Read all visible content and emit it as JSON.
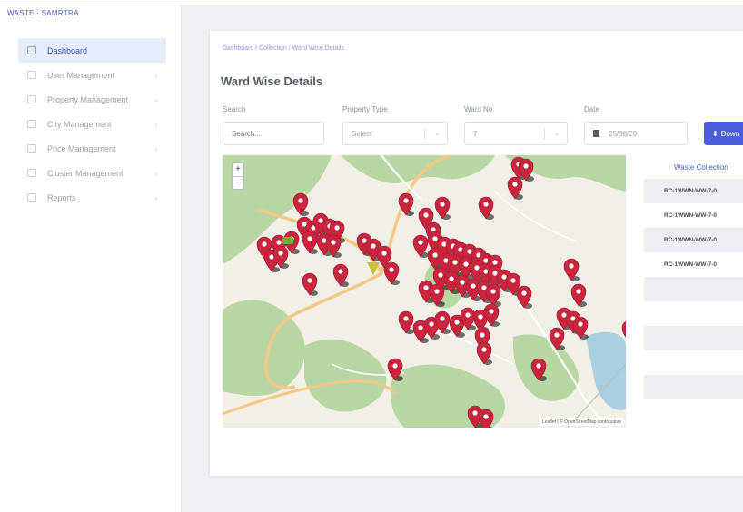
{
  "brand": {
    "text": "WASTE · SAMRTRA"
  },
  "sidebar": {
    "items": [
      {
        "label": "Dashboard",
        "active": true
      },
      {
        "label": "User Management",
        "active": false
      },
      {
        "label": "Property Management",
        "active": false
      },
      {
        "label": "City Management",
        "active": false
      },
      {
        "label": "Price Management",
        "active": false
      },
      {
        "label": "Cluster Management",
        "active": false
      },
      {
        "label": "Reports",
        "active": false
      }
    ]
  },
  "breadcrumb": {
    "text": "Dashboard / Collection / Ward Wise Details"
  },
  "page": {
    "title": "Ward Wise Details"
  },
  "filters": {
    "search": {
      "label": "Search",
      "placeholder": "Search..."
    },
    "property_type": {
      "label": "Property Type",
      "value": "Select"
    },
    "ward": {
      "label": "Ward No",
      "value": "7"
    },
    "date": {
      "label": "Date",
      "value": "25/08/20"
    },
    "download_label": "Down"
  },
  "map": {
    "zoom_in": "+",
    "zoom_out": "−",
    "attribution": "Leaflet | © OpenStreetMap contributors",
    "marker_color": "#c8263f",
    "highlight_marker_color": "#c8c23a"
  },
  "table": {
    "header": "Waste Collection",
    "rows": [
      "RC-1WWN-WW-7-0",
      "RC-1WWN-WW-7-0",
      "RC-1WWN-WW-7-0",
      "RC-1WWN-WW-7-0",
      "",
      "",
      "",
      "",
      ""
    ]
  },
  "colors": {
    "accent": "#4a5ee0",
    "sidebar_active_bg": "#e7ecfb"
  }
}
